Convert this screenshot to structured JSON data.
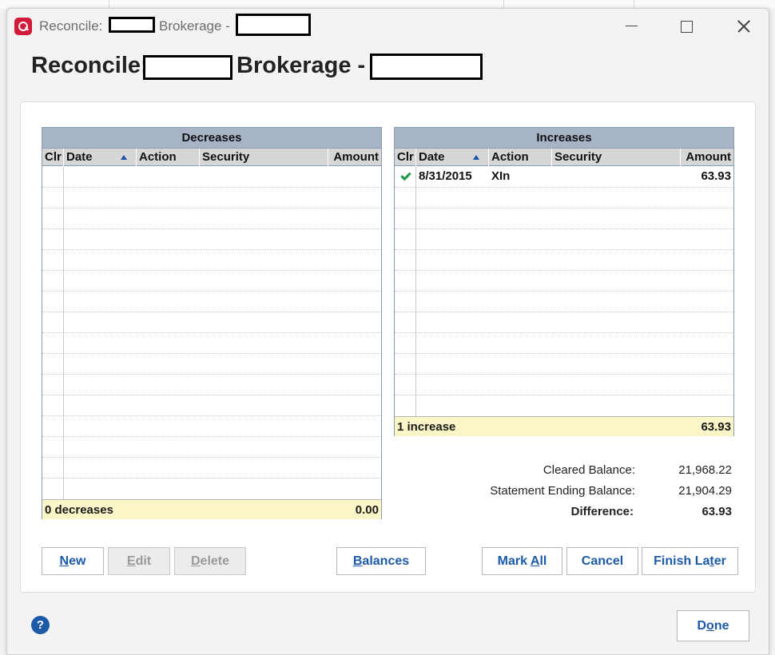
{
  "window": {
    "title_prefix": "Reconcile:",
    "title_middle": "Brokerage -",
    "heading_prefix": "Reconcile:",
    "heading_middle": "Brokerage -"
  },
  "decreases": {
    "title": "Decreases",
    "columns": [
      "Clr",
      "Date",
      "Action",
      "Security",
      "Amount"
    ],
    "rows": [],
    "footer_label": "0 decreases",
    "footer_total": "0.00"
  },
  "increases": {
    "title": "Increases",
    "columns": [
      "Clr",
      "Date",
      "Action",
      "Security",
      "Amount"
    ],
    "rows": [
      {
        "cleared": true,
        "date": "8/31/2015",
        "action": "XIn",
        "security": "",
        "amount": "63.93"
      }
    ],
    "footer_label": "1 increase",
    "footer_total": "63.93"
  },
  "balances": {
    "cleared_label": "Cleared Balance:",
    "cleared_value": "21,968.22",
    "statement_label": "Statement Ending Balance:",
    "statement_value": "21,904.29",
    "difference_label": "Difference:",
    "difference_value": "63.93"
  },
  "buttons": {
    "new": {
      "u": "N",
      "rest": "ew"
    },
    "edit": {
      "u": "E",
      "rest": "dit"
    },
    "delete": {
      "u": "D",
      "rest": "elete"
    },
    "balances": {
      "u": "B",
      "rest": "alances"
    },
    "mark_all": {
      "pre": "Mark ",
      "u": "A",
      "rest": "ll"
    },
    "cancel": "Cancel",
    "finish_later": {
      "pre": "Finish La",
      "u": "t",
      "rest": "er"
    },
    "done": {
      "pre": "D",
      "u": "o",
      "rest": "ne"
    }
  },
  "help": "?",
  "colors": {
    "register_header": "#a7b4c6",
    "footer_bg": "#fbf6c8",
    "button_text": "#1c5aa8",
    "check": "#1e9a4a",
    "app_icon": "#d31a3b"
  }
}
